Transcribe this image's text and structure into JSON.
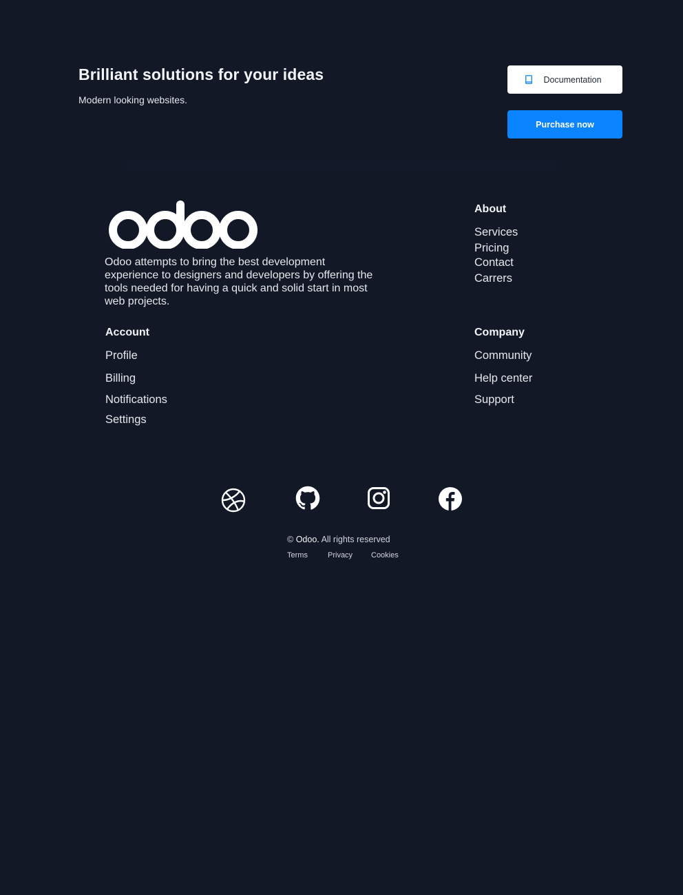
{
  "hero": {
    "title": "Brilliant solutions for your ideas",
    "subtitle": "Modern looking websites.",
    "docs_button": {
      "label": "Documentation",
      "icon": "book-icon"
    },
    "purchase_button": {
      "label": "Purchase now"
    }
  },
  "brand": {
    "logo_text": "odoo",
    "description": "Odoo attempts to bring the best development experience to designers and developers by offering the tools needed for having a quick and solid start in most web projects."
  },
  "columns": {
    "about": {
      "title": "About",
      "links": [
        "Services",
        "Pricing",
        "Contact",
        "Carrers"
      ]
    },
    "account": {
      "title": "Account",
      "links": [
        "Profile",
        "Billing",
        "Notifications",
        "Settings"
      ]
    },
    "company": {
      "title": "Company",
      "links": [
        "Community",
        "Help center",
        "Support"
      ]
    }
  },
  "social": [
    "dribbble-icon",
    "github-icon",
    "instagram-icon",
    "facebook-icon"
  ],
  "footer": {
    "copyright_symbol": "©",
    "copyright_brand": "Odoo.",
    "copyright_text": "All rights reserved",
    "legal_links": [
      "Terms",
      "Privacy",
      "Cookies"
    ]
  },
  "colors": {
    "background": "#121826",
    "accent": "#0a84ff",
    "text": "#e5e7eb"
  }
}
